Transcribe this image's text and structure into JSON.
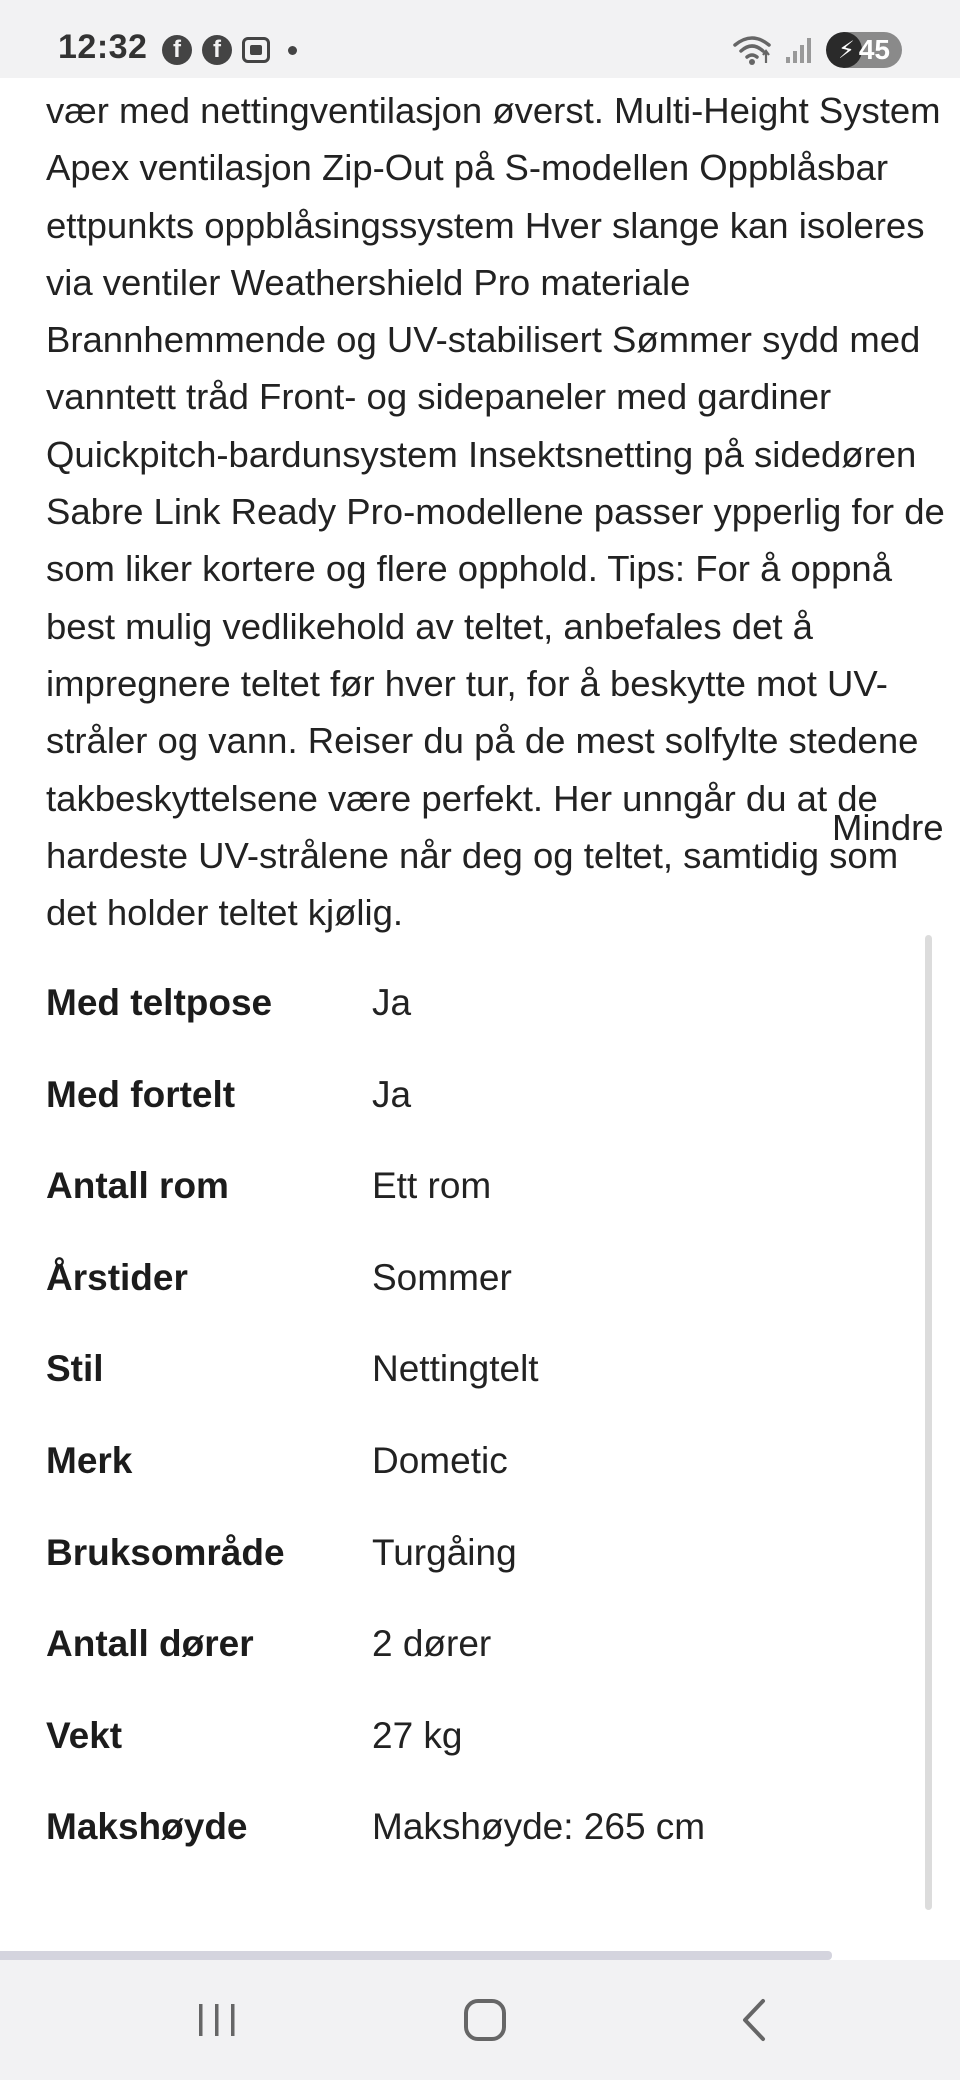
{
  "status_bar": {
    "time": "12:32",
    "battery_level": "45",
    "notification_icons": [
      "facebook-icon",
      "facebook-icon",
      "screenshot-icon",
      "dot-icon"
    ],
    "system_icons": [
      "wifi-icon",
      "signal-icon",
      "battery-charging-icon"
    ]
  },
  "description": {
    "lines": [
      "vær med nettingventilasjon øverst. Multi-Height System",
      "Apex ventilasjon Zip-Out på S-modellen Oppblåsbar",
      "ettpunkts oppblåsingssystem Hver slange kan isoleres",
      "via ventiler Weathershield Pro materiale",
      "Brannhemmende og UV-stabilisert Sømmer sydd med",
      "vanntett tråd Front- og sidepaneler med gardiner",
      "Quickpitch-bardunsystem Insektsnetting på sidedøren",
      "Sabre Link Ready Pro-modellene passer ypperlig for de",
      "som liker kortere og flere opphold. Tips: For å oppnå",
      "best mulig vedlikehold av teltet, anbefales det å",
      "impregnere teltet før hver tur, for å beskytte mot UV-",
      "stråler og vann. Reiser du på de mest solfylte stedene",
      "takbeskyttelsene være perfekt. Her unngår du at de",
      "hardeste UV-strålene når deg og teltet, samtidig som",
      "det holder teltet kjølig."
    ],
    "toggle_label": "Mindre"
  },
  "specs": [
    {
      "label": "Med teltpose",
      "value": "Ja"
    },
    {
      "label": "Med fortelt",
      "value": "Ja"
    },
    {
      "label": "Antall rom",
      "value": "Ett rom"
    },
    {
      "label": "Årstider",
      "value": "Sommer"
    },
    {
      "label": "Stil",
      "value": "Nettingtelt"
    },
    {
      "label": "Merk",
      "value": "Dometic"
    },
    {
      "label": "Bruksområde",
      "value": "Turgåing"
    },
    {
      "label": "Antall dører",
      "value": "2 dører"
    },
    {
      "label": "Vekt",
      "value": "27 kg"
    },
    {
      "label": "Makshøyde",
      "value": "Makshøyde: 265 cm"
    }
  ],
  "nav_bar": {
    "buttons": [
      "recent-apps-icon",
      "home-icon",
      "back-icon"
    ]
  }
}
